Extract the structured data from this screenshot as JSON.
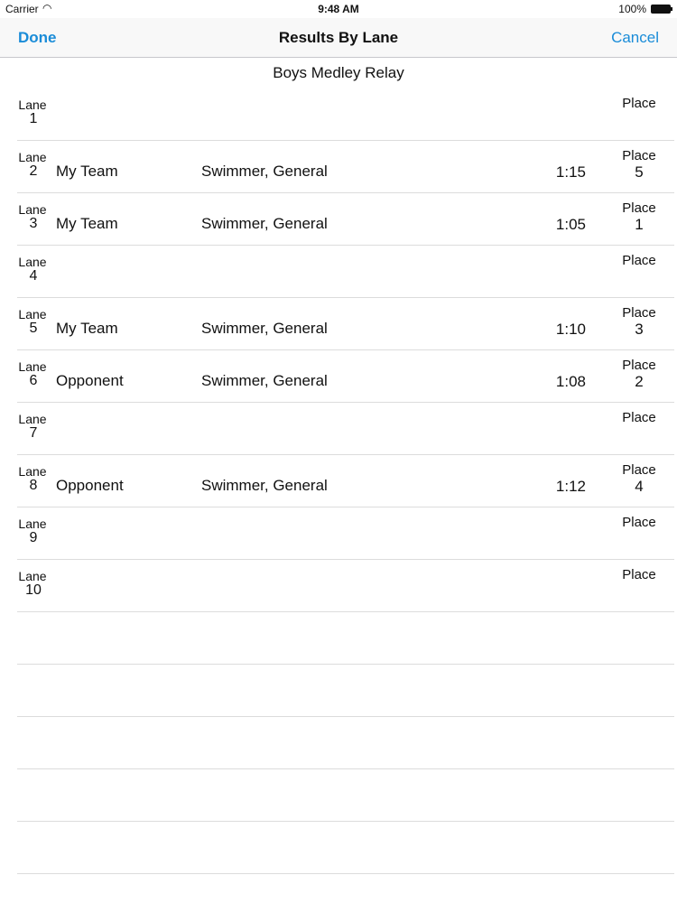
{
  "status_bar": {
    "carrier": "Carrier",
    "time": "9:48 AM",
    "battery": "100%"
  },
  "nav": {
    "done": "Done",
    "title": "Results By Lane",
    "cancel": "Cancel"
  },
  "event": {
    "title": "Boys Medley Relay"
  },
  "labels": {
    "lane": "Lane",
    "place": "Place"
  },
  "lanes": [
    {
      "lane": "1",
      "team": "",
      "swimmer": "",
      "time": "",
      "place": ""
    },
    {
      "lane": "2",
      "team": "My Team",
      "swimmer": "Swimmer, General",
      "time": "1:15",
      "place": "5"
    },
    {
      "lane": "3",
      "team": "My Team",
      "swimmer": "Swimmer, General",
      "time": "1:05",
      "place": "1"
    },
    {
      "lane": "4",
      "team": "",
      "swimmer": "",
      "time": "",
      "place": ""
    },
    {
      "lane": "5",
      "team": "My Team",
      "swimmer": "Swimmer, General",
      "time": "1:10",
      "place": "3"
    },
    {
      "lane": "6",
      "team": "Opponent",
      "swimmer": "Swimmer, General",
      "time": "1:08",
      "place": "2"
    },
    {
      "lane": "7",
      "team": "",
      "swimmer": "",
      "time": "",
      "place": ""
    },
    {
      "lane": "8",
      "team": "Opponent",
      "swimmer": "Swimmer, General",
      "time": "1:12",
      "place": "4"
    },
    {
      "lane": "9",
      "team": "",
      "swimmer": "",
      "time": "",
      "place": ""
    },
    {
      "lane": "10",
      "team": "",
      "swimmer": "",
      "time": "",
      "place": ""
    }
  ]
}
